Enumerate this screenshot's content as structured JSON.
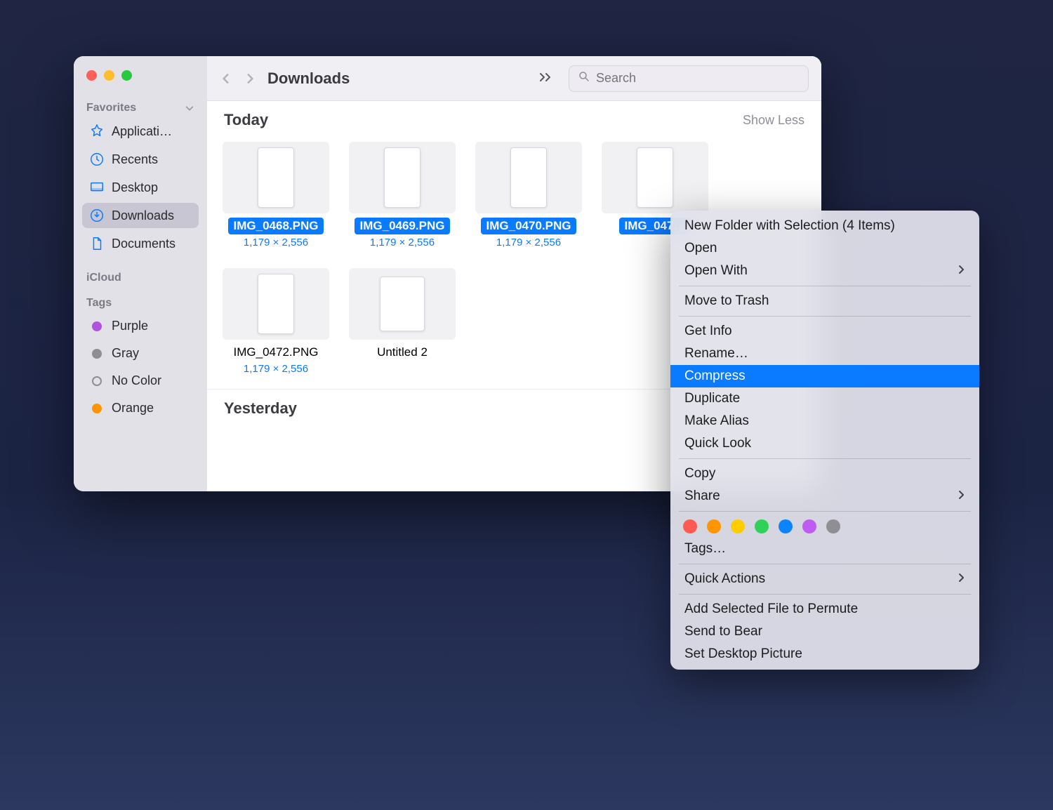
{
  "sidebar": {
    "sections": [
      {
        "title": "Favorites",
        "collapsible": true
      },
      {
        "title": "iCloud",
        "collapsible": false
      },
      {
        "title": "Tags",
        "collapsible": false
      }
    ],
    "favorites": [
      {
        "label": "Applicati…",
        "icon": "applications"
      },
      {
        "label": "Recents",
        "icon": "clock"
      },
      {
        "label": "Desktop",
        "icon": "desktop"
      },
      {
        "label": "Downloads",
        "icon": "downloads",
        "active": true
      },
      {
        "label": "Documents",
        "icon": "documents"
      }
    ],
    "tags": [
      {
        "label": "Purple",
        "color": "#af52de"
      },
      {
        "label": "Gray",
        "color": "#8e8e93"
      },
      {
        "label": "No Color",
        "color": "nocolor"
      },
      {
        "label": "Orange",
        "color": "#ff9500"
      }
    ]
  },
  "toolbar": {
    "title": "Downloads",
    "search_placeholder": "Search"
  },
  "groups": [
    {
      "title": "Today",
      "showless": "Show Less",
      "files": [
        {
          "name": "IMG_0468.PNG",
          "dim": "1,179 × 2,556",
          "selected": true
        },
        {
          "name": "IMG_0469.PNG",
          "dim": "1,179 × 2,556",
          "selected": true
        },
        {
          "name": "IMG_0470.PNG",
          "dim": "1,179 × 2,556",
          "selected": true
        },
        {
          "name": "IMG_047…",
          "dim": "",
          "selected": true,
          "truncated": true
        },
        {
          "name": "IMG_0472.PNG",
          "dim": "1,179 × 2,556",
          "selected": false
        },
        {
          "name": "Untitled 2",
          "dim": "",
          "selected": false,
          "wide": true
        }
      ]
    },
    {
      "title": "Yesterday"
    }
  ],
  "context_menu": {
    "items": [
      {
        "label": "New Folder with Selection (4 Items)"
      },
      {
        "label": "Open"
      },
      {
        "label": "Open With",
        "arrow": true
      },
      {
        "sep": true
      },
      {
        "label": "Move to Trash"
      },
      {
        "sep": true
      },
      {
        "label": "Get Info"
      },
      {
        "label": "Rename…"
      },
      {
        "label": "Compress",
        "highlight": true
      },
      {
        "label": "Duplicate"
      },
      {
        "label": "Make Alias"
      },
      {
        "label": "Quick Look"
      },
      {
        "sep": true
      },
      {
        "label": "Copy"
      },
      {
        "label": "Share",
        "arrow": true
      },
      {
        "sep": true
      },
      {
        "tags": [
          "#ff5a52",
          "#ff9500",
          "#ffcc00",
          "#30d158",
          "#0a84ff",
          "#bf5af2",
          "#8e8e93"
        ]
      },
      {
        "label": "Tags…"
      },
      {
        "sep": true
      },
      {
        "label": "Quick Actions",
        "arrow": true
      },
      {
        "sep": true
      },
      {
        "label": "Add Selected File to Permute"
      },
      {
        "label": "Send to Bear"
      },
      {
        "label": "Set Desktop Picture"
      }
    ]
  }
}
